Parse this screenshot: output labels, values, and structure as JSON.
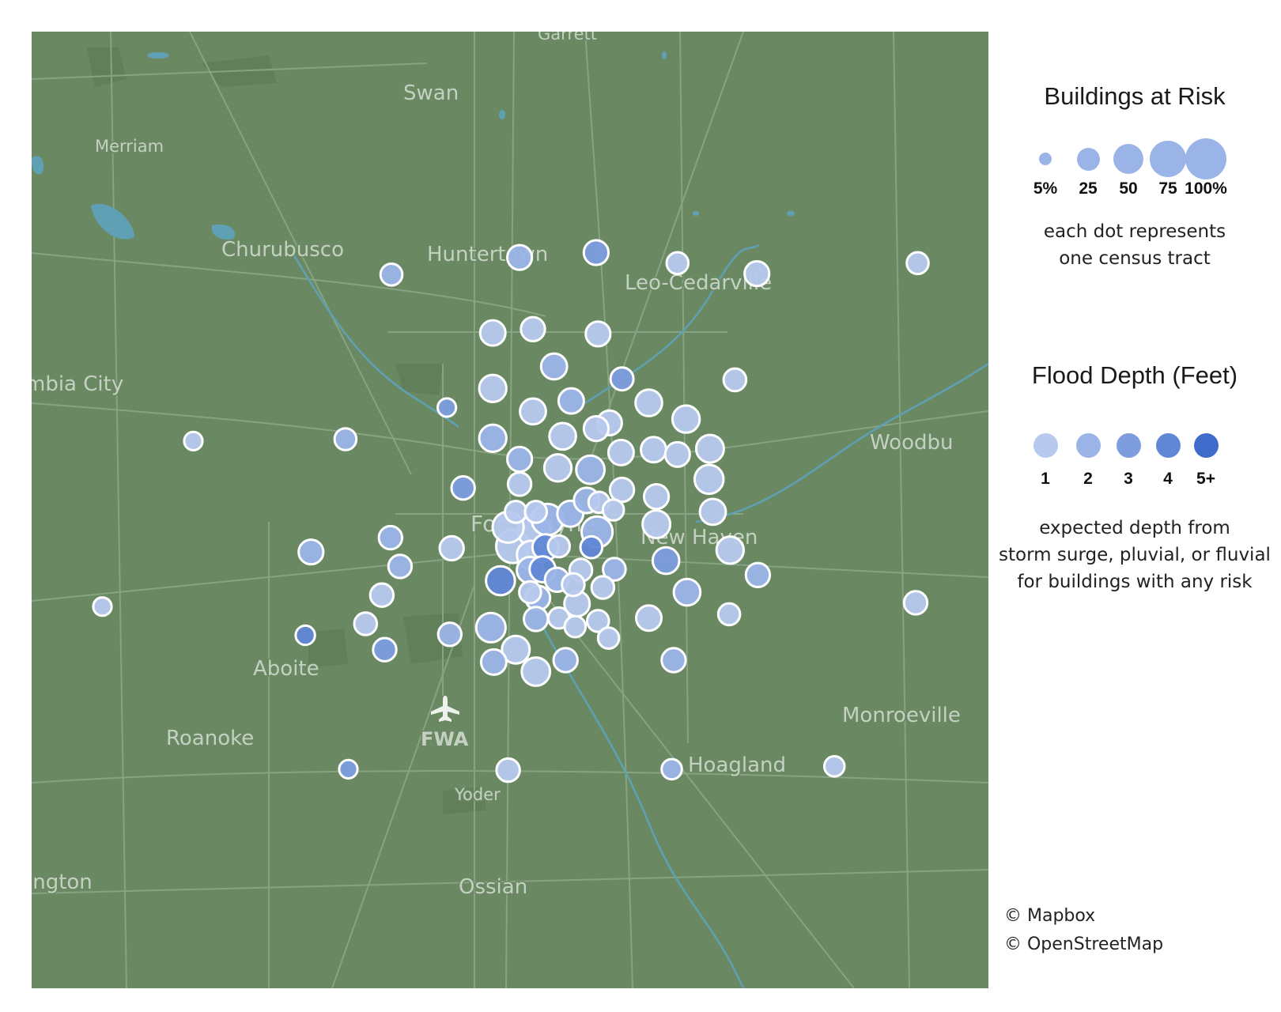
{
  "map": {
    "places": [
      {
        "name": "Garrett",
        "size": "sm"
      },
      {
        "name": "Swan",
        "size": "md"
      },
      {
        "name": "Merriam",
        "size": "sm"
      },
      {
        "name": "Churubusco",
        "size": "md"
      },
      {
        "name": "Huntertown",
        "size": "md"
      },
      {
        "name": "Leo-Cedarville",
        "size": "md"
      },
      {
        "name": "mbia City",
        "size": "md"
      },
      {
        "name": "Woodbu",
        "size": "md"
      },
      {
        "name": "Fort Wayne",
        "size": "lg"
      },
      {
        "name": "New Haven",
        "size": "md"
      },
      {
        "name": "Aboite",
        "size": "md"
      },
      {
        "name": "Roanoke",
        "size": "md"
      },
      {
        "name": "FWA",
        "size": "airport"
      },
      {
        "name": "Hoagland",
        "size": "md"
      },
      {
        "name": "Monroeville",
        "size": "md"
      },
      {
        "name": "Yoder",
        "size": "sm"
      },
      {
        "name": "Ossian",
        "size": "md"
      },
      {
        "name": "ington",
        "size": "md"
      }
    ],
    "airport_icon": "airplane-icon",
    "colors": {
      "land": "#6a8962",
      "water": "#5fa0b5",
      "road": "#88a383",
      "park": "#61805a"
    }
  },
  "chart_data": {
    "type": "scatter",
    "encoding": "each dot = one census tract; dot size = share of buildings at risk (%); dot color = expected flood depth class",
    "points": [
      {
        "x": 0.51,
        "y": 0.236,
        "risk": 30,
        "depth": 2
      },
      {
        "x": 0.59,
        "y": 0.231,
        "risk": 30,
        "depth": 3
      },
      {
        "x": 0.376,
        "y": 0.254,
        "risk": 22,
        "depth": 2
      },
      {
        "x": 0.675,
        "y": 0.242,
        "risk": 22,
        "depth": 1
      },
      {
        "x": 0.758,
        "y": 0.253,
        "risk": 30,
        "depth": 1
      },
      {
        "x": 0.926,
        "y": 0.242,
        "risk": 22,
        "depth": 1
      },
      {
        "x": 0.482,
        "y": 0.315,
        "risk": 32,
        "depth": 1
      },
      {
        "x": 0.524,
        "y": 0.311,
        "risk": 28,
        "depth": 1
      },
      {
        "x": 0.592,
        "y": 0.316,
        "risk": 30,
        "depth": 1
      },
      {
        "x": 0.546,
        "y": 0.35,
        "risk": 34,
        "depth": 2
      },
      {
        "x": 0.617,
        "y": 0.363,
        "risk": 25,
        "depth": 3
      },
      {
        "x": 0.735,
        "y": 0.364,
        "risk": 24,
        "depth": 1
      },
      {
        "x": 0.482,
        "y": 0.373,
        "risk": 38,
        "depth": 1
      },
      {
        "x": 0.524,
        "y": 0.397,
        "risk": 34,
        "depth": 1
      },
      {
        "x": 0.564,
        "y": 0.386,
        "risk": 32,
        "depth": 2
      },
      {
        "x": 0.604,
        "y": 0.409,
        "risk": 30,
        "depth": 1
      },
      {
        "x": 0.645,
        "y": 0.388,
        "risk": 36,
        "depth": 1
      },
      {
        "x": 0.684,
        "y": 0.405,
        "risk": 38,
        "depth": 1
      },
      {
        "x": 0.434,
        "y": 0.393,
        "risk": 14,
        "depth": 3
      },
      {
        "x": 0.169,
        "y": 0.428,
        "risk": 14,
        "depth": 1
      },
      {
        "x": 0.328,
        "y": 0.426,
        "risk": 22,
        "depth": 2
      },
      {
        "x": 0.482,
        "y": 0.425,
        "risk": 38,
        "depth": 2
      },
      {
        "x": 0.555,
        "y": 0.423,
        "risk": 36,
        "depth": 1
      },
      {
        "x": 0.59,
        "y": 0.415,
        "risk": 30,
        "depth": 1
      },
      {
        "x": 0.616,
        "y": 0.44,
        "risk": 32,
        "depth": 1
      },
      {
        "x": 0.65,
        "y": 0.437,
        "risk": 32,
        "depth": 1
      },
      {
        "x": 0.675,
        "y": 0.442,
        "risk": 30,
        "depth": 1
      },
      {
        "x": 0.709,
        "y": 0.436,
        "risk": 40,
        "depth": 1
      },
      {
        "x": 0.51,
        "y": 0.447,
        "risk": 30,
        "depth": 2
      },
      {
        "x": 0.55,
        "y": 0.456,
        "risk": 38,
        "depth": 1
      },
      {
        "x": 0.584,
        "y": 0.458,
        "risk": 42,
        "depth": 2
      },
      {
        "x": 0.708,
        "y": 0.468,
        "risk": 44,
        "depth": 1
      },
      {
        "x": 0.451,
        "y": 0.477,
        "risk": 26,
        "depth": 3
      },
      {
        "x": 0.51,
        "y": 0.473,
        "risk": 26,
        "depth": 1
      },
      {
        "x": 0.58,
        "y": 0.49,
        "risk": 32,
        "depth": 2
      },
      {
        "x": 0.617,
        "y": 0.479,
        "risk": 28,
        "depth": 1
      },
      {
        "x": 0.653,
        "y": 0.486,
        "risk": 30,
        "depth": 1
      },
      {
        "x": 0.593,
        "y": 0.492,
        "risk": 20,
        "depth": 1
      },
      {
        "x": 0.539,
        "y": 0.51,
        "risk": 54,
        "depth": 2
      },
      {
        "x": 0.563,
        "y": 0.504,
        "risk": 34,
        "depth": 2
      },
      {
        "x": 0.506,
        "y": 0.502,
        "risk": 22,
        "depth": 1
      },
      {
        "x": 0.527,
        "y": 0.502,
        "risk": 22,
        "depth": 1
      },
      {
        "x": 0.608,
        "y": 0.5,
        "risk": 20,
        "depth": 1
      },
      {
        "x": 0.653,
        "y": 0.515,
        "risk": 40,
        "depth": 1
      },
      {
        "x": 0.712,
        "y": 0.502,
        "risk": 34,
        "depth": 1
      },
      {
        "x": 0.498,
        "y": 0.518,
        "risk": 52,
        "depth": 1
      },
      {
        "x": 0.525,
        "y": 0.522,
        "risk": 58,
        "depth": 1
      },
      {
        "x": 0.591,
        "y": 0.523,
        "risk": 52,
        "depth": 2
      },
      {
        "x": 0.503,
        "y": 0.538,
        "risk": 62,
        "depth": 1
      },
      {
        "x": 0.522,
        "y": 0.547,
        "risk": 42,
        "depth": 1
      },
      {
        "x": 0.537,
        "y": 0.539,
        "risk": 34,
        "depth": 4
      },
      {
        "x": 0.551,
        "y": 0.538,
        "risk": 22,
        "depth": 1
      },
      {
        "x": 0.585,
        "y": 0.539,
        "risk": 22,
        "depth": 4
      },
      {
        "x": 0.292,
        "y": 0.544,
        "risk": 30,
        "depth": 2
      },
      {
        "x": 0.375,
        "y": 0.529,
        "risk": 26,
        "depth": 2
      },
      {
        "x": 0.439,
        "y": 0.54,
        "risk": 28,
        "depth": 1
      },
      {
        "x": 0.73,
        "y": 0.542,
        "risk": 38,
        "depth": 1
      },
      {
        "x": 0.385,
        "y": 0.559,
        "risk": 26,
        "depth": 2
      },
      {
        "x": 0.521,
        "y": 0.563,
        "risk": 36,
        "depth": 2
      },
      {
        "x": 0.534,
        "y": 0.562,
        "risk": 34,
        "depth": 4
      },
      {
        "x": 0.574,
        "y": 0.563,
        "risk": 24,
        "depth": 1
      },
      {
        "x": 0.609,
        "y": 0.562,
        "risk": 24,
        "depth": 2
      },
      {
        "x": 0.663,
        "y": 0.553,
        "risk": 36,
        "depth": 3
      },
      {
        "x": 0.759,
        "y": 0.568,
        "risk": 28,
        "depth": 2
      },
      {
        "x": 0.49,
        "y": 0.574,
        "risk": 44,
        "depth": 4
      },
      {
        "x": 0.549,
        "y": 0.573,
        "risk": 28,
        "depth": 2
      },
      {
        "x": 0.529,
        "y": 0.592,
        "risk": 30,
        "depth": 2
      },
      {
        "x": 0.521,
        "y": 0.586,
        "risk": 22,
        "depth": 1
      },
      {
        "x": 0.566,
        "y": 0.578,
        "risk": 24,
        "depth": 1
      },
      {
        "x": 0.597,
        "y": 0.581,
        "risk": 24,
        "depth": 1
      },
      {
        "x": 0.685,
        "y": 0.586,
        "risk": 36,
        "depth": 2
      },
      {
        "x": 0.57,
        "y": 0.598,
        "risk": 32,
        "depth": 1
      },
      {
        "x": 0.366,
        "y": 0.589,
        "risk": 26,
        "depth": 1
      },
      {
        "x": 0.074,
        "y": 0.601,
        "risk": 14,
        "depth": 1
      },
      {
        "x": 0.924,
        "y": 0.597,
        "risk": 26,
        "depth": 1
      },
      {
        "x": 0.349,
        "y": 0.619,
        "risk": 24,
        "depth": 1
      },
      {
        "x": 0.48,
        "y": 0.623,
        "risk": 46,
        "depth": 2
      },
      {
        "x": 0.527,
        "y": 0.614,
        "risk": 28,
        "depth": 2
      },
      {
        "x": 0.551,
        "y": 0.613,
        "risk": 20,
        "depth": 1
      },
      {
        "x": 0.592,
        "y": 0.616,
        "risk": 22,
        "depth": 1
      },
      {
        "x": 0.645,
        "y": 0.613,
        "risk": 32,
        "depth": 1
      },
      {
        "x": 0.729,
        "y": 0.609,
        "risk": 22,
        "depth": 1
      },
      {
        "x": 0.286,
        "y": 0.631,
        "risk": 16,
        "depth": 4
      },
      {
        "x": 0.437,
        "y": 0.63,
        "risk": 26,
        "depth": 2
      },
      {
        "x": 0.568,
        "y": 0.622,
        "risk": 20,
        "depth": 1
      },
      {
        "x": 0.603,
        "y": 0.634,
        "risk": 20,
        "depth": 1
      },
      {
        "x": 0.369,
        "y": 0.646,
        "risk": 26,
        "depth": 3
      },
      {
        "x": 0.506,
        "y": 0.646,
        "risk": 40,
        "depth": 1
      },
      {
        "x": 0.483,
        "y": 0.659,
        "risk": 32,
        "depth": 2
      },
      {
        "x": 0.527,
        "y": 0.669,
        "risk": 42,
        "depth": 1
      },
      {
        "x": 0.558,
        "y": 0.657,
        "risk": 28,
        "depth": 2
      },
      {
        "x": 0.671,
        "y": 0.657,
        "risk": 28,
        "depth": 2
      },
      {
        "x": 0.331,
        "y": 0.771,
        "risk": 14,
        "depth": 3
      },
      {
        "x": 0.498,
        "y": 0.772,
        "risk": 26,
        "depth": 1
      },
      {
        "x": 0.669,
        "y": 0.771,
        "risk": 18,
        "depth": 2
      },
      {
        "x": 0.839,
        "y": 0.768,
        "risk": 18,
        "depth": 1
      }
    ]
  },
  "legend": {
    "size": {
      "title": "Buildings at Risk",
      "labels": [
        "5%",
        "25",
        "50",
        "75",
        "100%"
      ],
      "values": [
        5,
        25,
        50,
        75,
        100
      ],
      "note_lines": [
        "each dot represents",
        "one census tract"
      ]
    },
    "depth": {
      "title": "Flood Depth (Feet)",
      "labels": [
        "1",
        "2",
        "3",
        "4",
        "5+"
      ],
      "colors": [
        "#b7c9ee",
        "#9bb4e8",
        "#7d9ddf",
        "#6087d6",
        "#3f6bca"
      ],
      "note_lines": [
        "expected depth from",
        "storm surge, pluvial, or fluvial",
        "for buildings with any risk"
      ]
    }
  },
  "attribution": [
    "© Mapbox",
    "© OpenStreetMap"
  ]
}
